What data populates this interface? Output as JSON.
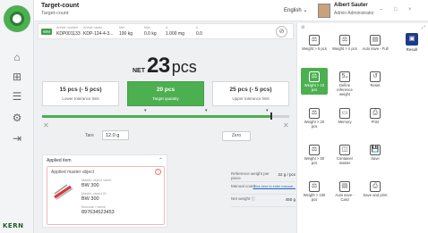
{
  "header": {
    "title": "Target-count",
    "subtitle": "Target-count",
    "language": "English",
    "user_name": "Albert Sauter",
    "user_role": "Admin Administrator",
    "win_min": "–",
    "win_max": "□",
    "win_close": "×"
  },
  "info_strip": {
    "chip": "WM",
    "fields": [
      {
        "label": "Article number",
        "value": "KDP001133"
      },
      {
        "label": "Article name",
        "value": "KDP-124-4-3..."
      },
      {
        "label": "Min",
        "value": "100 kg"
      },
      {
        "label": "Max",
        "value": "0.0 kg"
      },
      {
        "label": "d",
        "value": "1.000 mg"
      },
      {
        "label": "e",
        "value": "0.0"
      }
    ]
  },
  "weight": {
    "prefix": "NET",
    "value": "23",
    "unit": "pcs"
  },
  "tolerances": [
    {
      "value": "15 pcs (- 5 pcs)",
      "label": "Lower tolerance limit",
      "active": false
    },
    {
      "value": "20 pcs",
      "label": "Target quantity",
      "active": true
    },
    {
      "value": "25 pcs (- 5 pcs)",
      "label": "Upper tolerance limit",
      "active": false
    }
  ],
  "progress": {
    "fraction": 0.93,
    "tick_low": "▾",
    "tick_mid": "▾",
    "tick_high": "▾"
  },
  "tare": {
    "label": "Tare",
    "value": "12.0 g"
  },
  "zero": {
    "label": "Zero"
  },
  "applied": {
    "section_title": "Applied item",
    "card_title": "Applied master object",
    "warn": "!",
    "fields": [
      {
        "label": "Master object name",
        "value": "BW 300"
      },
      {
        "label": "Master object ID",
        "value": "BW 300"
      },
      {
        "label": "Barcode / name",
        "value": "897634523453"
      }
    ]
  },
  "info_table": [
    {
      "label": "Reference weight per piece",
      "value": "22 g / pcs",
      "link": false
    },
    {
      "label": "Manual count",
      "value": "Click here to enter manual...",
      "link": true
    },
    {
      "label": "Net weight ⓘ",
      "value": "450 g",
      "link": false
    }
  ],
  "right_panel": {
    "result_label": "Result",
    "tiles": [
      {
        "icon": "⚖",
        "label": "Weight > 5 pcs",
        "green": false
      },
      {
        "icon": "⚖",
        "label": "Weight > n pcs",
        "green": false
      },
      {
        "icon": "▤",
        "label": "Auto save - Full",
        "green": false
      },
      {
        "icon": "⚖",
        "label": "Weight > 10 pcs",
        "green": true
      },
      {
        "icon": "5₄",
        "label": "Define reference weight",
        "green": false
      },
      {
        "icon": "↺",
        "label": "Reset",
        "green": false
      },
      {
        "icon": "⚖",
        "label": "Weight > 20 pcs",
        "green": false
      },
      {
        "icon": "▭",
        "label": "Memory",
        "green": false
      },
      {
        "icon": "⎙",
        "label": "Print",
        "green": false
      },
      {
        "icon": "⚖",
        "label": "Weight > 50 pcs",
        "green": false
      },
      {
        "icon": "◫",
        "label": "Container master",
        "green": false
      },
      {
        "icon": "💾",
        "label": "Save",
        "green": false
      },
      {
        "icon": "⚖",
        "label": "Weight > 100 pcs",
        "green": false
      },
      {
        "icon": "▤",
        "label": "Auto save - Card",
        "green": false
      },
      {
        "icon": "⎙",
        "label": "Save and print",
        "green": false
      }
    ]
  }
}
